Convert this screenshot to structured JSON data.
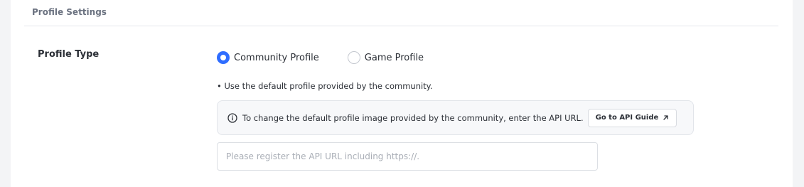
{
  "section": {
    "title": "Profile Settings"
  },
  "profile_type": {
    "label": "Profile Type",
    "options": [
      {
        "label": "Community Profile",
        "selected": true
      },
      {
        "label": "Game Profile",
        "selected": false
      }
    ],
    "help_text": "• Use the default profile provided by the community."
  },
  "notice": {
    "icon": "info-icon",
    "text": "To change the default profile image provided by the community, enter the API URL.",
    "button_label": "Go to API Guide",
    "button_icon": "external-link-icon"
  },
  "api_url": {
    "value": "",
    "placeholder": "Please register the API URL including https://."
  },
  "colors": {
    "accent": "#2f6dff",
    "text": "#2b2f36",
    "muted": "#6b7280",
    "placeholder": "#a9aeb6",
    "notice_bg": "#f7f8fa"
  }
}
